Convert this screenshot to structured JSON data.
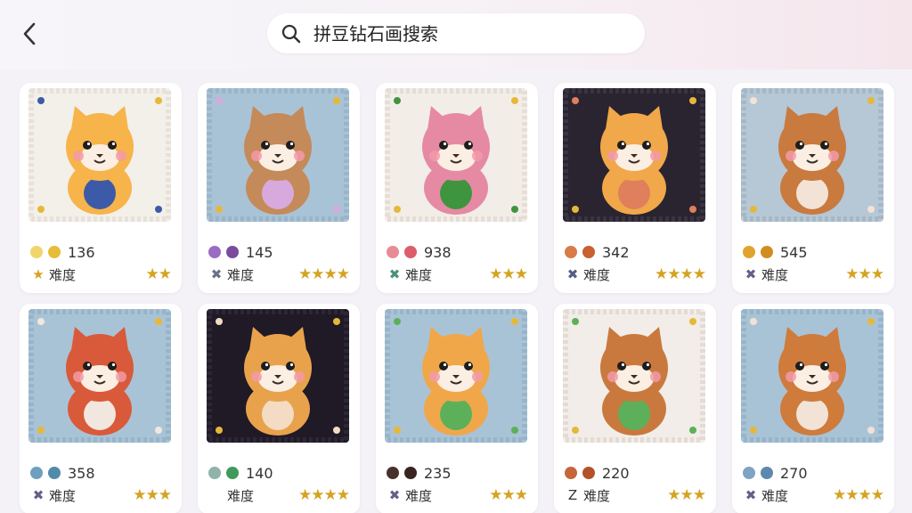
{
  "search": {
    "query": "拼豆钻石画搜索"
  },
  "cards": [
    {
      "colors": [
        "#f1d46a",
        "#e6bd3a"
      ],
      "count": "136",
      "marker": "★",
      "marker_color": "#d4a322",
      "label": "难度",
      "stars": "★★",
      "bg": "#f3efe9",
      "border": "#e7e1da",
      "figure": "#f6b44a",
      "accent": "#3d5aa8"
    },
    {
      "colors": [
        "#9c6cc2",
        "#7b4c9d"
      ],
      "count": "145",
      "marker": "✖",
      "marker_color": "#6a6f8a",
      "label": "难度",
      "stars": "★★★★",
      "bg": "#a9c3d6",
      "border": "#9bb5c8",
      "figure": "#c58a5a",
      "accent": "#d8a9dd"
    },
    {
      "colors": [
        "#e98b96",
        "#dd5d6c"
      ],
      "count": "938",
      "marker": "✖",
      "marker_color": "#4e8f78",
      "label": "难度",
      "stars": "★★★",
      "bg": "#f3ede8",
      "border": "#e6ddd6",
      "figure": "#e58aa2",
      "accent": "#3f9440"
    },
    {
      "colors": [
        "#d87b47",
        "#c8602f"
      ],
      "count": "342",
      "marker": "✖",
      "marker_color": "#585c80",
      "label": "难度",
      "stars": "★★★★",
      "bg": "#2a2430",
      "border": "#3a3342",
      "figure": "#f0a84a",
      "accent": "#e07f5c"
    },
    {
      "colors": [
        "#e0a42e",
        "#d28d22"
      ],
      "count": "545",
      "marker": "✖",
      "marker_color": "#6a5c8a",
      "label": "难度",
      "stars": "★★★",
      "bg": "#b6c7d6",
      "border": "#a6b7c6",
      "figure": "#c97a3e",
      "accent": "#f2e3d6"
    },
    {
      "colors": [
        "#6f9fbf",
        "#528aaa"
      ],
      "count": "358",
      "marker": "✖",
      "marker_color": "#6a5c8a",
      "label": "难度",
      "stars": "★★★",
      "bg": "#a9c3d6",
      "border": "#98b4c8",
      "figure": "#d95a3a",
      "accent": "#f2e7df"
    },
    {
      "colors": [
        "#8fb3a8",
        "#3f9a5c"
      ],
      "count": "140",
      "marker": "",
      "marker_color": "#333333",
      "label": "难度",
      "stars": "★★★★",
      "bg": "#1f1a26",
      "border": "#2d2636",
      "figure": "#e9a24c",
      "accent": "#f3dcc3"
    },
    {
      "colors": [
        "#4a302c",
        "#3a2420"
      ],
      "count": "235",
      "marker": "✖",
      "marker_color": "#6a5c8a",
      "label": "难度",
      "stars": "★★★",
      "bg": "#a9c3d6",
      "border": "#98b4c8",
      "figure": "#f0a74a",
      "accent": "#5db05a"
    },
    {
      "colors": [
        "#c5653a",
        "#b3522a"
      ],
      "count": "220",
      "marker": "Z",
      "marker_color": "#333333",
      "label": "难度",
      "stars": "★★★",
      "bg": "#f2ede8",
      "border": "#e3dbd4",
      "figure": "#c9793e",
      "accent": "#5db05a"
    },
    {
      "colors": [
        "#7ea3c4",
        "#5e88ae"
      ],
      "count": "270",
      "marker": "✖",
      "marker_color": "#6a5c8a",
      "label": "难度",
      "stars": "★★★★",
      "bg": "#a9c3d6",
      "border": "#98b4c8",
      "figure": "#cf7b3c",
      "accent": "#f2e3d6"
    }
  ]
}
